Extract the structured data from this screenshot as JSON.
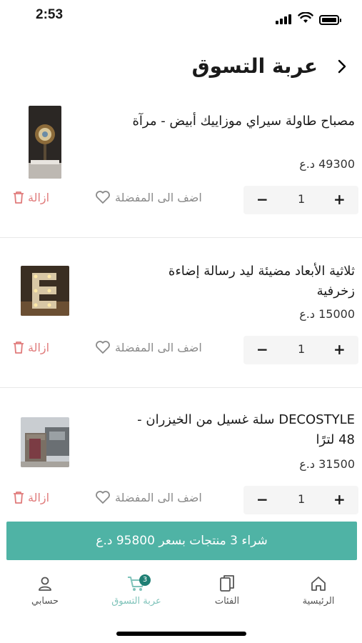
{
  "status": {
    "time": "2:53"
  },
  "header": {
    "title": "عربة التسوق"
  },
  "items": [
    {
      "name": "مصباح طاولة سيراي موزاييك  أبيض - مرآة",
      "price": "49300 د.ع",
      "qty": "1"
    },
    {
      "name": "ثلاثية الأبعاد مضيئة ليد رسالة إضاءة زخرفية",
      "price": "15000 د.ع",
      "qty": "1"
    },
    {
      "name": "DECOSTYLE سلة غسيل من الخيزران - 48 لترًا",
      "price": "31500 د.ع",
      "qty": "1"
    }
  ],
  "actions": {
    "remove_label": "ازالة",
    "favorite_label": "اضف الى المفضلة",
    "minus": "−",
    "plus": "+"
  },
  "checkout": {
    "label": "شراء 3 منتجات بسعر 95800 د.ع"
  },
  "nav": {
    "home": "الرئيسية",
    "categories": "الفئات",
    "cart": "عربة التسوق",
    "cart_badge": "3",
    "account": "حسابي"
  },
  "colors": {
    "accent": "#4fb3a5",
    "remove": "#e07b7b",
    "active_nav": "#7fc3ba"
  }
}
